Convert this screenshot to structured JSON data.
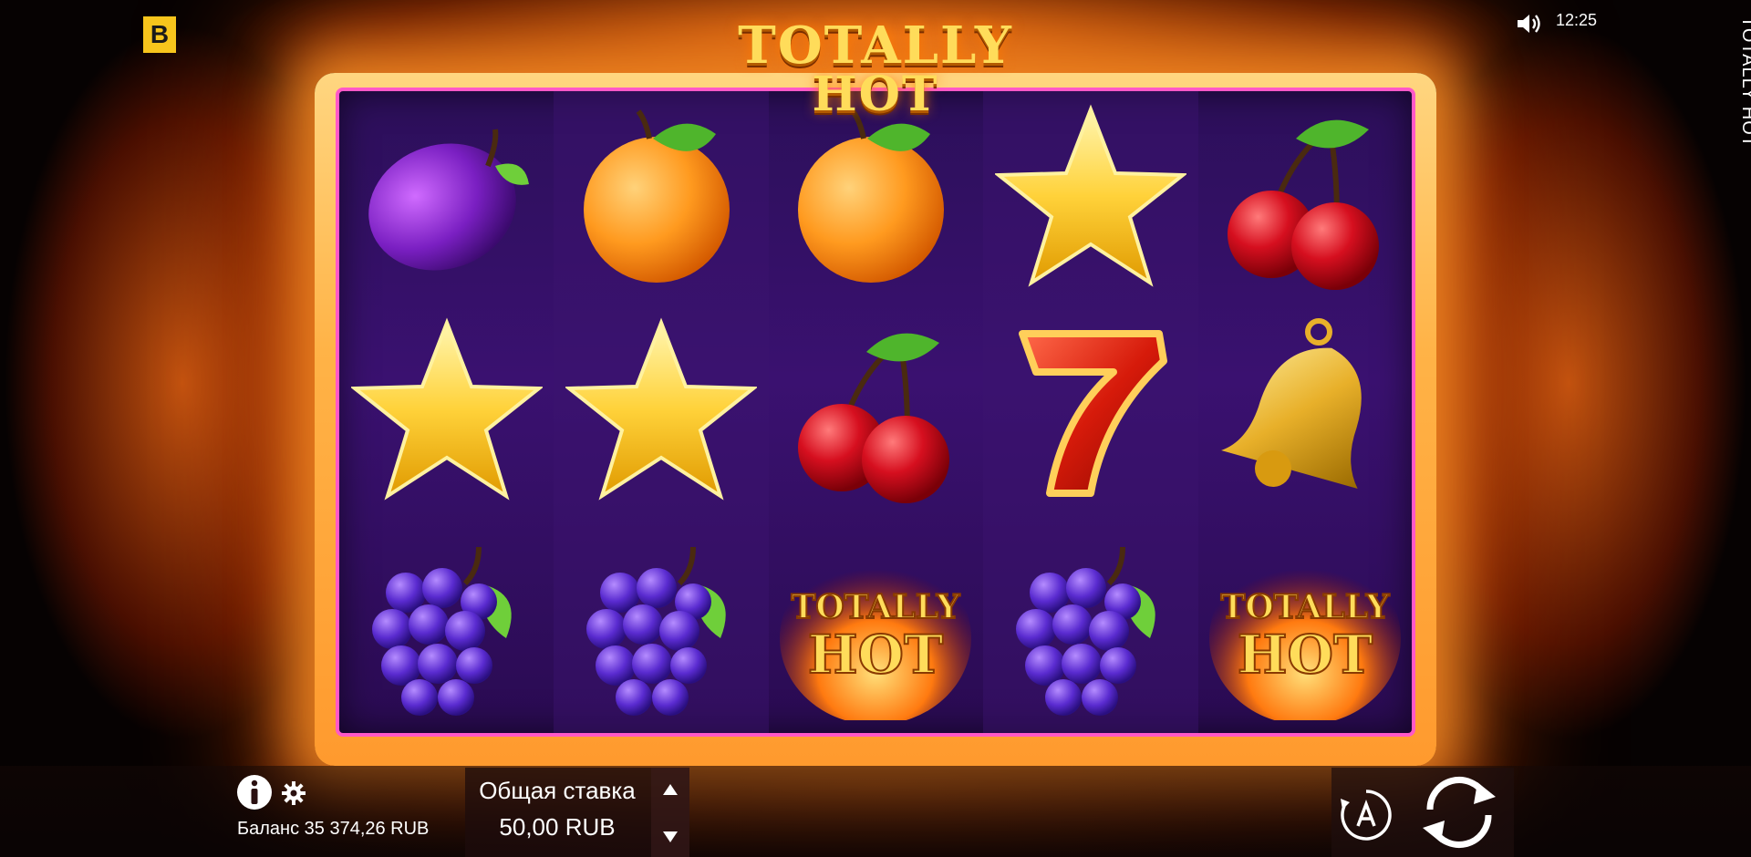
{
  "app": {
    "brand_letter": "B",
    "clock": "12:25",
    "vertical_title": "TOTALLY HOT"
  },
  "logo": {
    "line1": "TOTALLY",
    "line2": "HOT"
  },
  "reels": {
    "columns": [
      [
        "plum",
        "star",
        "grapes"
      ],
      [
        "orange",
        "star",
        "grapes"
      ],
      [
        "orange",
        "cherries",
        "totally-hot"
      ],
      [
        "star",
        "seven",
        "grapes"
      ],
      [
        "cherries",
        "bell",
        "totally-hot"
      ]
    ],
    "wild_text_line1": "TOTALLY",
    "wild_text_line2": "HOT"
  },
  "bottom_bar": {
    "balance": "Баланс 35 374,26 RUB",
    "bet_label": "Общая ставка",
    "bet_value": "50,00 RUB"
  },
  "icons": {
    "sound": "speaker-icon",
    "info": "info-icon",
    "settings": "gear-icon",
    "bet_up": "caret-up-icon",
    "bet_down": "caret-down-icon",
    "autoplay": "autoplay-icon",
    "spin": "spin-icon"
  },
  "colors": {
    "reel_bg": "#3a1170",
    "frame": "#ffb347",
    "brand": "#f7c51c",
    "logo_gold": "#ffdc5a"
  }
}
